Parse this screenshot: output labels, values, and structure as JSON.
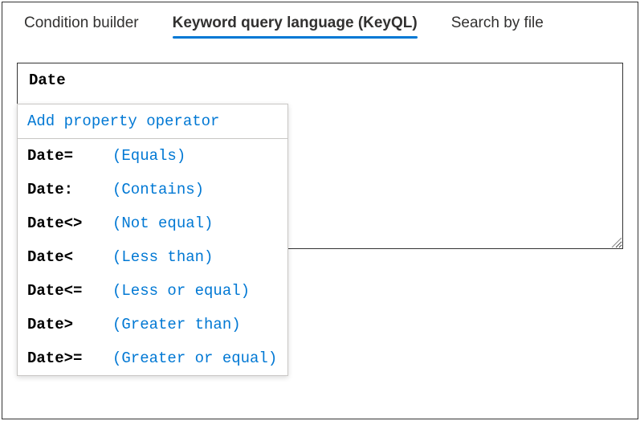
{
  "tabs": {
    "condition": "Condition builder",
    "keyql": "Keyword query language (KeyQL)",
    "file": "Search by file"
  },
  "textarea": {
    "value": "Date"
  },
  "dropdown": {
    "header": "Add property operator",
    "items": [
      {
        "op": "Date=",
        "desc": "(Equals)"
      },
      {
        "op": "Date:",
        "desc": "(Contains)"
      },
      {
        "op": "Date<>",
        "desc": "(Not equal)"
      },
      {
        "op": "Date<",
        "desc": "(Less than)"
      },
      {
        "op": "Date<=",
        "desc": "(Less or equal)"
      },
      {
        "op": "Date>",
        "desc": "(Greater than)"
      },
      {
        "op": "Date>=",
        "desc": "(Greater or equal)"
      }
    ]
  }
}
